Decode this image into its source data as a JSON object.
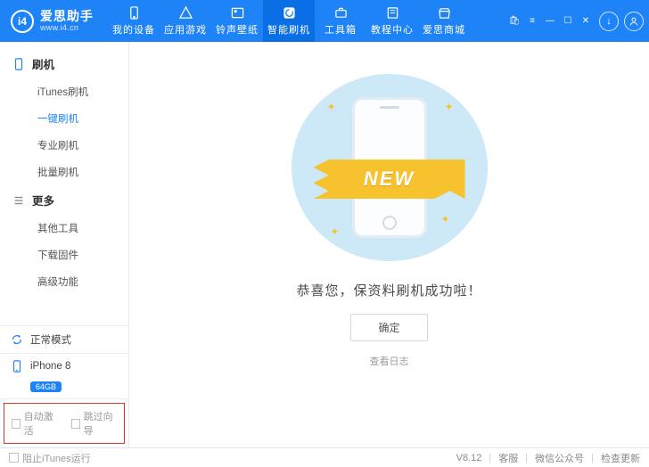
{
  "brand": {
    "name": "爱思助手",
    "url": "www.i4.cn",
    "logo_letter": "i4"
  },
  "nav": [
    {
      "id": "my-device",
      "label": "我的设备"
    },
    {
      "id": "app-game",
      "label": "应用游戏"
    },
    {
      "id": "ring-wall",
      "label": "铃声壁纸"
    },
    {
      "id": "smart-flash",
      "label": "智能刷机"
    },
    {
      "id": "toolbox",
      "label": "工具箱"
    },
    {
      "id": "tutorial",
      "label": "教程中心"
    },
    {
      "id": "store",
      "label": "爱思商城"
    }
  ],
  "nav_active": 3,
  "sidebar": {
    "sections": [
      {
        "title": "刷机",
        "items": [
          {
            "id": "itunes-flash",
            "label": "iTunes刷机"
          },
          {
            "id": "onekey-flash",
            "label": "一键刷机",
            "selected": true
          },
          {
            "id": "pro-flash",
            "label": "专业刷机"
          },
          {
            "id": "batch-flash",
            "label": "批量刷机"
          }
        ]
      },
      {
        "title": "更多",
        "items": [
          {
            "id": "other-tools",
            "label": "其他工具"
          },
          {
            "id": "download-fw",
            "label": "下载固件"
          },
          {
            "id": "advanced",
            "label": "高级功能"
          }
        ]
      }
    ]
  },
  "device_mode": {
    "label": "正常模式"
  },
  "device": {
    "name": "iPhone 8",
    "capacity": "64GB"
  },
  "bottom_checks": {
    "auto_activate": "自动激活",
    "skip_guide": "跳过向导"
  },
  "main": {
    "ribbon_text": "NEW",
    "success_text": "恭喜您，保资料刷机成功啦！",
    "ok_label": "确定",
    "log_link": "查看日志"
  },
  "statusbar": {
    "block_itunes": "阻止iTunes运行",
    "version": "V8.12",
    "support": "客服",
    "wechat": "微信公众号",
    "check_update": "检查更新"
  }
}
